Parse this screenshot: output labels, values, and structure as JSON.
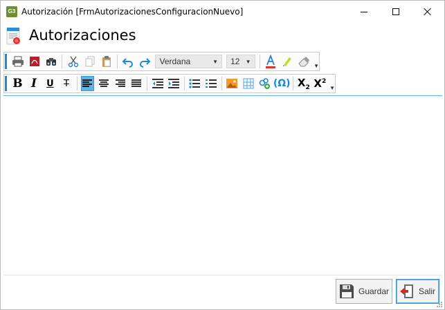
{
  "window": {
    "title": "Autorización [FrmAutorizacionesConfiguracionNuevo]",
    "app_icon_text": "G3"
  },
  "header": {
    "title": "Autorizaciones"
  },
  "toolbar1": {
    "font_name": "Verdana",
    "font_size": "12"
  },
  "toolbar2": {},
  "footer": {
    "save_label": "Guardar",
    "exit_label": "Salir"
  },
  "colors": {
    "accent": "#1e88d8",
    "active_button": "#5ab4e8"
  }
}
